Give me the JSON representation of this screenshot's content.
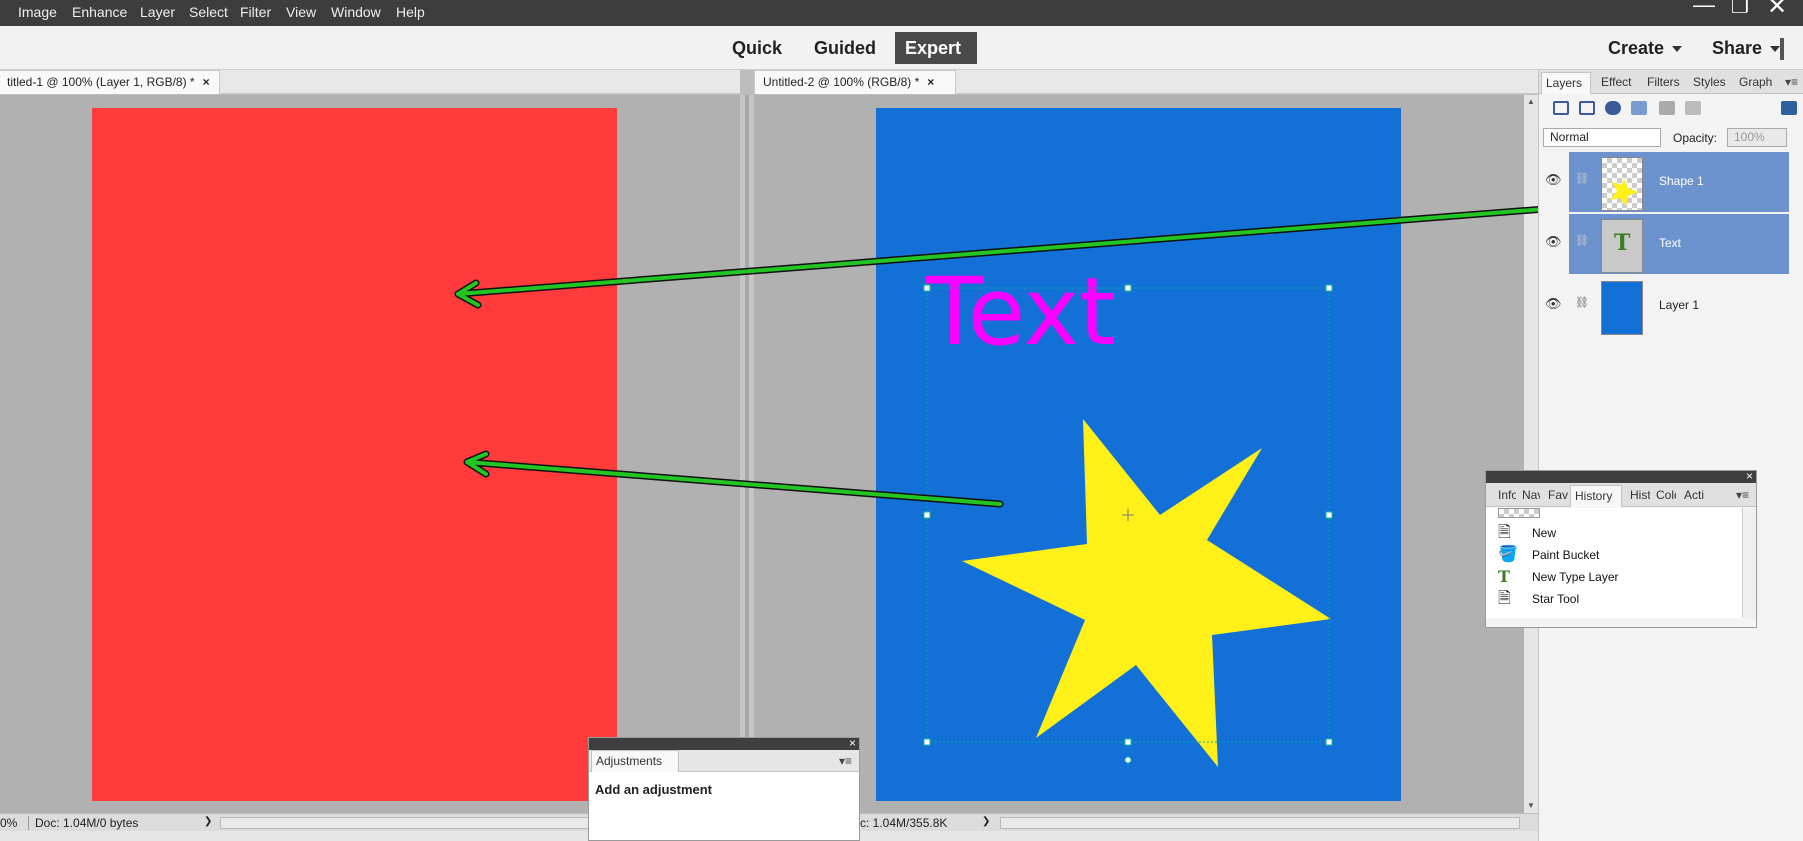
{
  "menu": [
    "Image",
    "Enhance",
    "Layer",
    "Select",
    "Filter",
    "View",
    "Window",
    "Help"
  ],
  "modes": {
    "quick": "Quick",
    "guided": "Guided",
    "expert": "Expert"
  },
  "header": {
    "create": "Create",
    "share": "Share"
  },
  "docs": [
    {
      "tab": "titled-1 @ 100% (Layer 1, RGB/8) *",
      "status_zoom": "0%",
      "status_doc": "Doc: 1.04M/0 bytes",
      "canvas_color": "#ff3b3b"
    },
    {
      "tab": "Untitled-2 @ 100% (RGB/8) *",
      "status_doc": "c: 1.04M/355.8K",
      "canvas_color": "#1270d6",
      "text_layer": "Text",
      "text_color": "#ff00ff",
      "star_color": "#fff01a"
    }
  ],
  "arrow_color": "#22c522",
  "layers_panel": {
    "tabs": [
      "Layers",
      "Effect",
      "Filters",
      "Styles",
      "Graph"
    ],
    "blend_mode": "Normal",
    "opacity_label": "Opacity:",
    "opacity_value": "100%",
    "layers": [
      {
        "name": "Shape 1",
        "selected": true
      },
      {
        "name": "Text",
        "selected": true
      },
      {
        "name": "Layer 1",
        "selected": false
      }
    ]
  },
  "history_panel": {
    "tabs": [
      "Info",
      "Nav",
      "Fav",
      "History",
      "Hist",
      "Colo",
      "Acti"
    ],
    "items": [
      {
        "label": "New",
        "icon": "new-document-icon"
      },
      {
        "label": "Paint Bucket",
        "icon": "paint-bucket-icon"
      },
      {
        "label": "New Type Layer",
        "icon": "type-tool-icon"
      },
      {
        "label": "Star Tool",
        "icon": "shape-tool-icon"
      }
    ]
  },
  "adjustments_panel": {
    "tab": "Adjustments",
    "body": "Add an adjustment"
  }
}
